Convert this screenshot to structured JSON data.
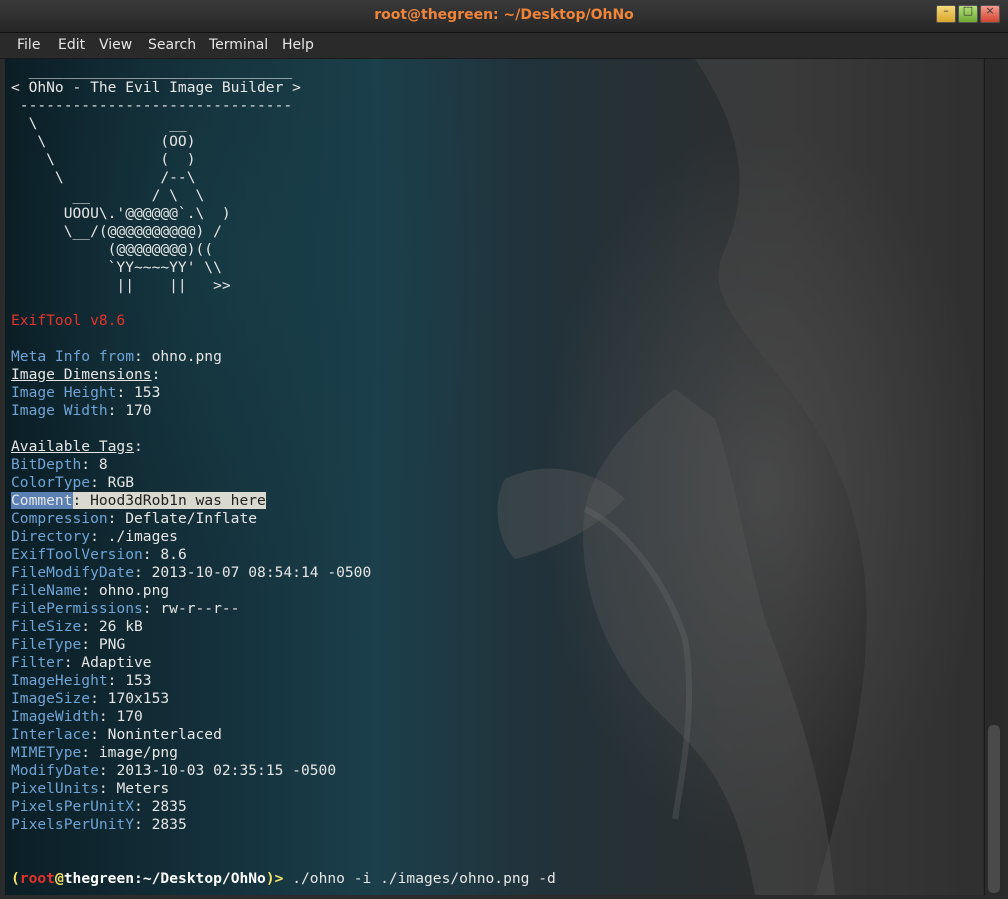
{
  "window": {
    "title": "root@thegreen: ~/Desktop/OhNo"
  },
  "menu": [
    "File",
    "Edit",
    "View",
    "Search",
    "Terminal",
    "Help"
  ],
  "banner": {
    "lines": [
      "  ______________________________",
      "< OhNo - The Evil Image Builder >",
      " -------------------------------",
      "  \\               __",
      "   \\             (OO)",
      "    \\            (  )",
      "     \\           /--\\",
      "       __       / \\  \\",
      "      UOOU\\.'@@@@@@`.\\  )",
      "      \\__/(@@@@@@@@@@) /",
      "           (@@@@@@@@)((",
      "           `YY~~~~YY' \\\\",
      "            ||    ||   >>"
    ]
  },
  "exiftool_version": "ExifTool v8.6",
  "meta": {
    "meta_label": "Meta Info from",
    "meta_value": "ohno.png",
    "dimensions_header": "Image Dimensions",
    "height_label": "Image Height",
    "height_value": "153",
    "width_label": "Image Width",
    "width_value": "170"
  },
  "tags_header": "Available Tags",
  "tags": [
    {
      "key": "BitDepth",
      "value": "8"
    },
    {
      "key": "ColorType",
      "value": "RGB"
    },
    {
      "key": "Comment",
      "value": "Hood3dRob1n was here",
      "selected": true
    },
    {
      "key": "Compression",
      "value": "Deflate/Inflate"
    },
    {
      "key": "Directory",
      "value": "./images"
    },
    {
      "key": "ExifToolVersion",
      "value": "8.6"
    },
    {
      "key": "FileModifyDate",
      "value": "2013-10-07 08:54:14 -0500"
    },
    {
      "key": "FileName",
      "value": "ohno.png"
    },
    {
      "key": "FilePermissions",
      "value": "rw-r--r--"
    },
    {
      "key": "FileSize",
      "value": "26 kB"
    },
    {
      "key": "FileType",
      "value": "PNG"
    },
    {
      "key": "Filter",
      "value": "Adaptive"
    },
    {
      "key": "ImageHeight",
      "value": "153"
    },
    {
      "key": "ImageSize",
      "value": "170x153"
    },
    {
      "key": "ImageWidth",
      "value": "170"
    },
    {
      "key": "Interlace",
      "value": "Noninterlaced"
    },
    {
      "key": "MIMEType",
      "value": "image/png"
    },
    {
      "key": "ModifyDate",
      "value": "2013-10-03 02:35:15 -0500"
    },
    {
      "key": "PixelUnits",
      "value": "Meters"
    },
    {
      "key": "PixelsPerUnitX",
      "value": "2835"
    },
    {
      "key": "PixelsPerUnitY",
      "value": "2835"
    }
  ],
  "prompt": {
    "open": "(",
    "user": "root",
    "at": "@",
    "host": "thegreen",
    "path": ":~/Desktop/OhNo",
    "close": ")>",
    "command": " ./ohno -i ./images/ohno.png -d"
  },
  "colors": {
    "title": "#f0853a",
    "label": "#6fa4d6",
    "red": "#e5332b",
    "prompt_yellow": "#f2e46b"
  }
}
